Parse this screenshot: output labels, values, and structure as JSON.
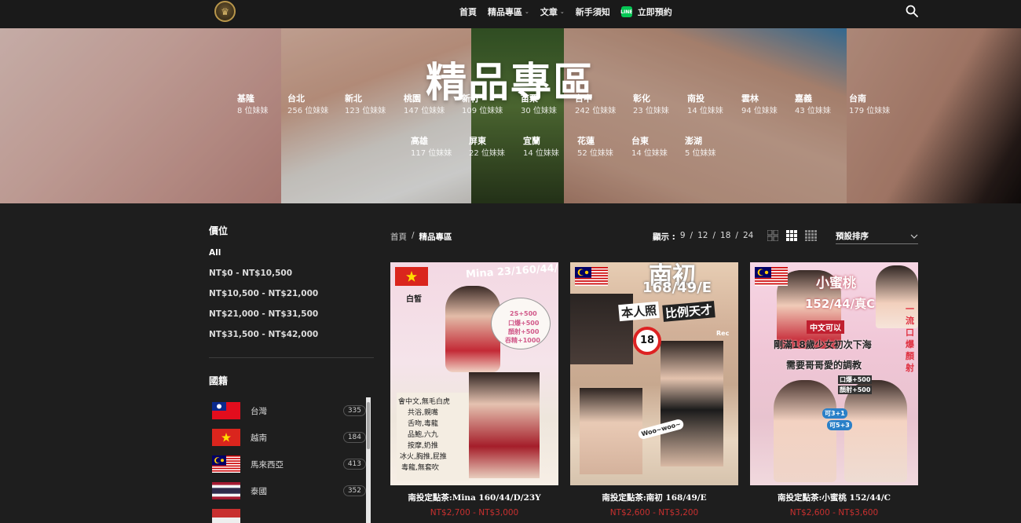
{
  "header": {
    "nav": [
      {
        "label": "首頁",
        "dropdown": false
      },
      {
        "label": "精品專區",
        "dropdown": true
      },
      {
        "label": "文章",
        "dropdown": true
      },
      {
        "label": "新手須知",
        "dropdown": false
      },
      {
        "label": "立即預約",
        "dropdown": false,
        "icon": "line-icon",
        "icon_text": "LINE"
      }
    ]
  },
  "hero": {
    "title": "精品專區",
    "regions": [
      {
        "name": "基隆",
        "count": "8 位妹妹"
      },
      {
        "name": "台北",
        "count": "256 位妹妹"
      },
      {
        "name": "新北",
        "count": "123 位妹妹"
      },
      {
        "name": "桃園",
        "count": "147 位妹妹"
      },
      {
        "name": "新竹",
        "count": "109 位妹妹"
      },
      {
        "name": "苗栗",
        "count": "30 位妹妹"
      },
      {
        "name": "台中",
        "count": "242 位妹妹"
      },
      {
        "name": "彰化",
        "count": "23 位妹妹"
      },
      {
        "name": "南投",
        "count": "14 位妹妹"
      },
      {
        "name": "雲林",
        "count": "94 位妹妹"
      },
      {
        "name": "嘉義",
        "count": "43 位妹妹"
      },
      {
        "name": "台南",
        "count": "179 位妹妹"
      },
      {
        "name": "高雄",
        "count": "117 位妹妹"
      },
      {
        "name": "屏東",
        "count": "22 位妹妹"
      },
      {
        "name": "宜蘭",
        "count": "14 位妹妹"
      },
      {
        "name": "花蓮",
        "count": "52 位妹妹"
      },
      {
        "name": "台東",
        "count": "14 位妹妹"
      },
      {
        "name": "澎湖",
        "count": "5 位妹妹"
      }
    ]
  },
  "sidebar": {
    "price_title": "價位",
    "prices": [
      "All",
      "NT$0 - NT$10,500",
      "NT$10,500 - NT$21,000",
      "NT$21,000 - NT$31,500",
      "NT$31,500 - NT$42,000"
    ],
    "nationality_title": "國籍",
    "nationalities": [
      {
        "name": "台灣",
        "count": "335",
        "flag": "taiwan"
      },
      {
        "name": "越南",
        "count": "184",
        "flag": "vietnam"
      },
      {
        "name": "馬來西亞",
        "count": "413",
        "flag": "malaysia"
      },
      {
        "name": "泰國",
        "count": "352",
        "flag": "thailand"
      }
    ]
  },
  "toolbar": {
    "breadcrumb_home": "首頁",
    "breadcrumb_sep": "/",
    "breadcrumb_current": "精品專區",
    "show_label": "顯示 :",
    "show_options": [
      "9",
      "12",
      "18",
      "24"
    ],
    "show_sep": "/",
    "sort_label": "預設排序"
  },
  "products": [
    {
      "title": "南投定點茶:Mina 160/44/D/23Y",
      "price": "NT$2,700 - NT$3,000",
      "flag": "vietnam",
      "overlay": [
        "Mina 23/160/44/D",
        "白皙",
        "2S+500",
        "口爆+500",
        "顏射+500",
        "吞精+1000",
        "會中文,無毛白虎",
        "共浴,親嘴",
        "舌吻,毒龍",
        "品鮑,六九",
        "按摩,奶推",
        "冰火,胸推,屁推",
        "毒龍,無套吹"
      ]
    },
    {
      "title": "南投定點茶:南初 168/49/E",
      "price": "NT$2,600 - NT$3,200",
      "flag": "malaysia",
      "overlay": [
        "南初",
        "168/49/E",
        "本人照",
        "比例天才",
        "18",
        "Rec",
        "Woo~woo~"
      ]
    },
    {
      "title": "南投定點茶:小蜜桃 152/44/C",
      "price": "NT$2,600 - NT$3,600",
      "flag": "malaysia",
      "overlay": [
        "小蜜桃",
        "152/44/真C",
        "中文可以",
        "剛滿18歲少女初次下海",
        "需要哥哥愛的調教",
        "口爆+500",
        "顏射+500",
        "可3+1",
        "可5+3",
        "一流口爆顏射"
      ]
    }
  ],
  "colors": {
    "accent_price": "#c8302f",
    "background": "#1e1e1e",
    "line_green": "#06c755"
  }
}
